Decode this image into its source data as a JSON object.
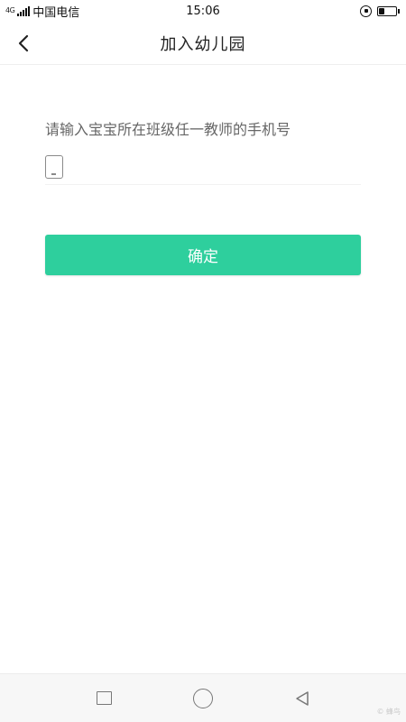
{
  "status_bar": {
    "network": "4G",
    "carrier": "中国电信",
    "time": "15:06",
    "battery_level": 0.35
  },
  "header": {
    "title": "加入幼儿园"
  },
  "form": {
    "prompt": "请输入宝宝所在班级任一教师的手机号",
    "phone_value": "",
    "phone_placeholder": ""
  },
  "actions": {
    "confirm_label": "确定"
  },
  "system_nav": {
    "watermark": "© 蜂鸟"
  },
  "colors": {
    "accent": "#2ecf9d",
    "prompt_text": "#666666",
    "background": "#ffffff"
  },
  "icons": {
    "back": "chevron-left-icon",
    "phone": "mobile-phone-icon",
    "lock": "rotation-lock-icon",
    "battery": "battery-icon",
    "recents": "square-icon",
    "home": "circle-icon",
    "system_back": "triangle-back-icon"
  }
}
